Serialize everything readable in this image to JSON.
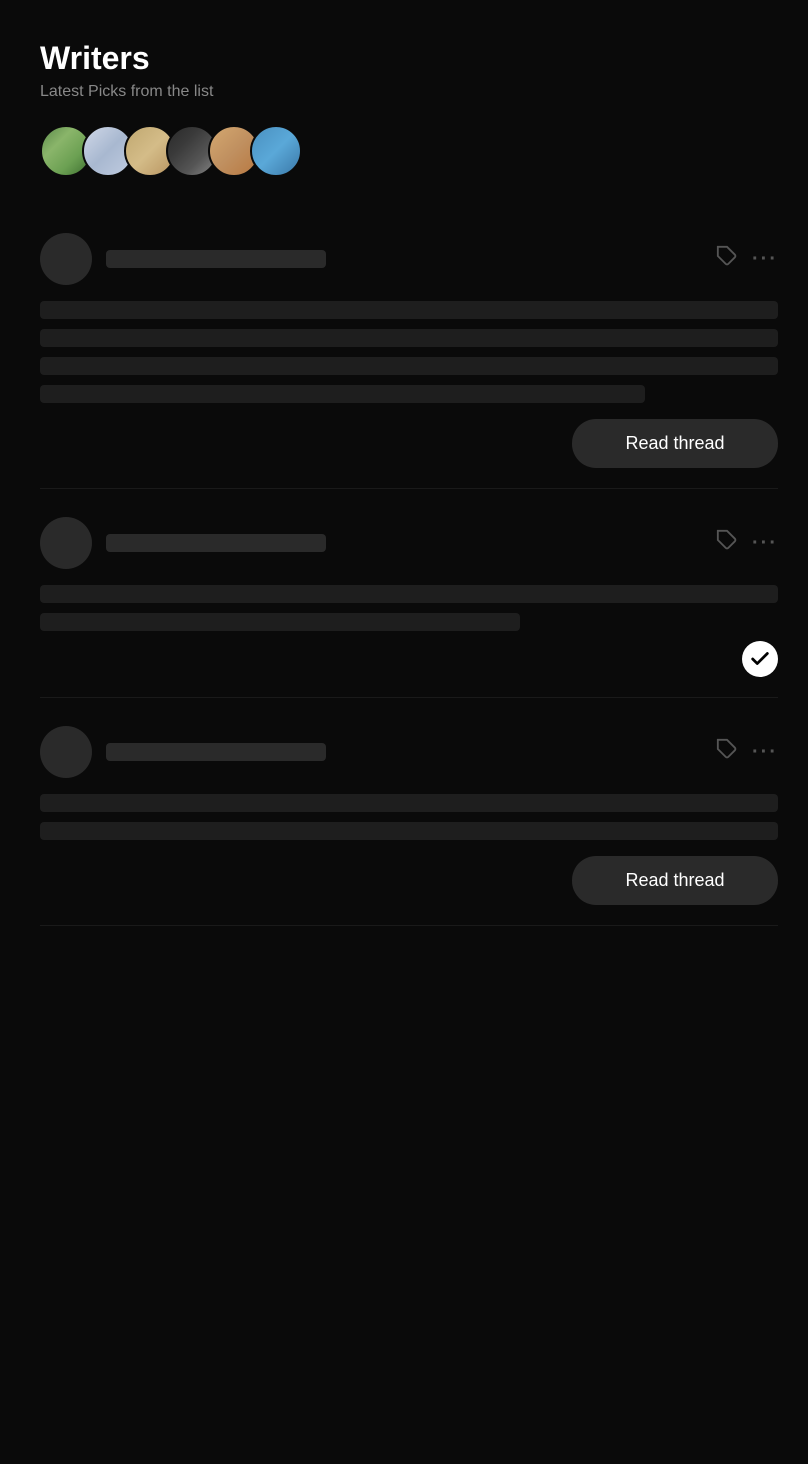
{
  "page": {
    "title": "Writers",
    "subtitle": "Latest Picks from the list"
  },
  "avatars": [
    {
      "id": "avatar-1",
      "class": "avatar-1"
    },
    {
      "id": "avatar-2",
      "class": "avatar-2"
    },
    {
      "id": "avatar-3",
      "class": "avatar-3"
    },
    {
      "id": "avatar-4",
      "class": "avatar-4"
    },
    {
      "id": "avatar-5",
      "class": "avatar-5"
    },
    {
      "id": "avatar-6",
      "class": "avatar-6"
    }
  ],
  "threads": [
    {
      "id": "thread-1",
      "has_read_button": true,
      "has_checkmark": false,
      "read_button_label": "Read thread",
      "skeleton_lines": [
        "full",
        "full",
        "partial"
      ]
    },
    {
      "id": "thread-2",
      "has_read_button": false,
      "has_checkmark": true,
      "read_button_label": "",
      "skeleton_lines": [
        "full",
        "medium"
      ]
    },
    {
      "id": "thread-3",
      "has_read_button": true,
      "has_checkmark": false,
      "read_button_label": "Read thread",
      "skeleton_lines": [
        "full",
        "full"
      ]
    }
  ],
  "icons": {
    "tag": "⬡",
    "more": "···",
    "checkmark": "✓"
  }
}
